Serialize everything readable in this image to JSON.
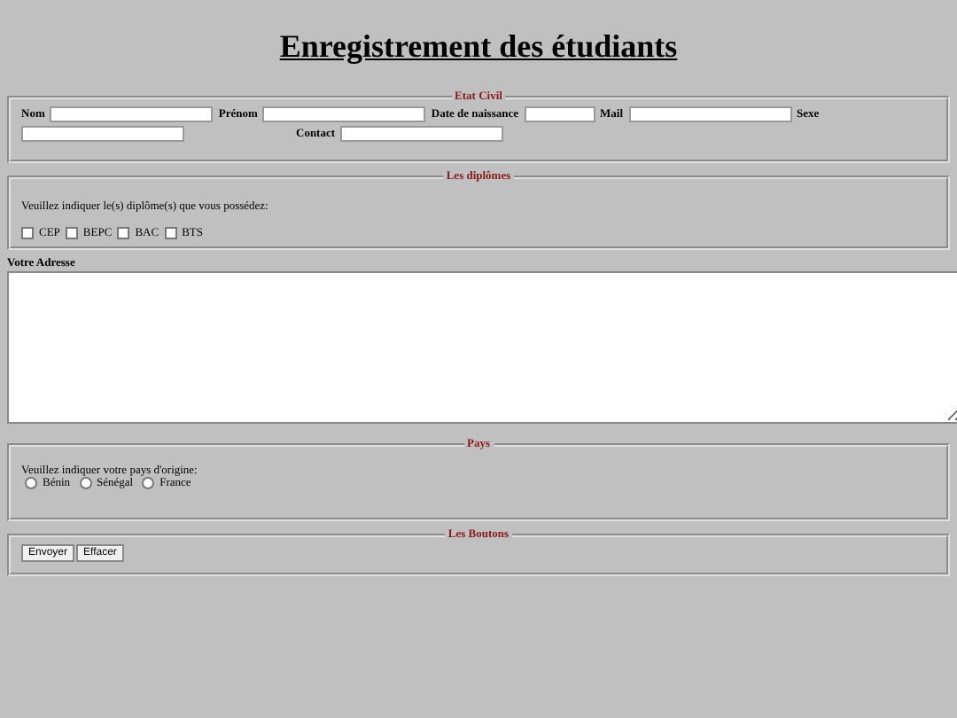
{
  "title": "Enregistrement des étudiants",
  "etat_civil": {
    "legend": "Etat Civil",
    "fields": [
      {
        "label": "Nom",
        "kind": "text"
      },
      {
        "label": "Prénom",
        "kind": "text"
      },
      {
        "label": "Date de naissance",
        "kind": "date"
      },
      {
        "label": "Mail",
        "kind": "text"
      },
      {
        "label": "Sexe",
        "kind": "text"
      },
      {
        "label": "Contact",
        "kind": "text"
      }
    ]
  },
  "diplomes": {
    "legend": "Les diplômes",
    "prompt": "Veuillez indiquer le(s) diplôme(s) que vous possédez:",
    "options": [
      {
        "label": "CEP",
        "checked": false
      },
      {
        "label": "BEPC",
        "checked": false
      },
      {
        "label": "BAC",
        "checked": false
      },
      {
        "label": "BTS",
        "checked": false
      }
    ]
  },
  "adresse": {
    "label": "Votre Adresse"
  },
  "pays": {
    "legend": "Pays",
    "prompt": "Veuillez indiquer votre pays d'origine:",
    "options": [
      {
        "label": "Bénin",
        "selected": false
      },
      {
        "label": "Sénégal",
        "selected": false
      },
      {
        "label": "France",
        "selected": false
      }
    ]
  },
  "boutons": {
    "legend": "Les Boutons",
    "buttons": [
      "Envoyer",
      "Effacer"
    ]
  }
}
